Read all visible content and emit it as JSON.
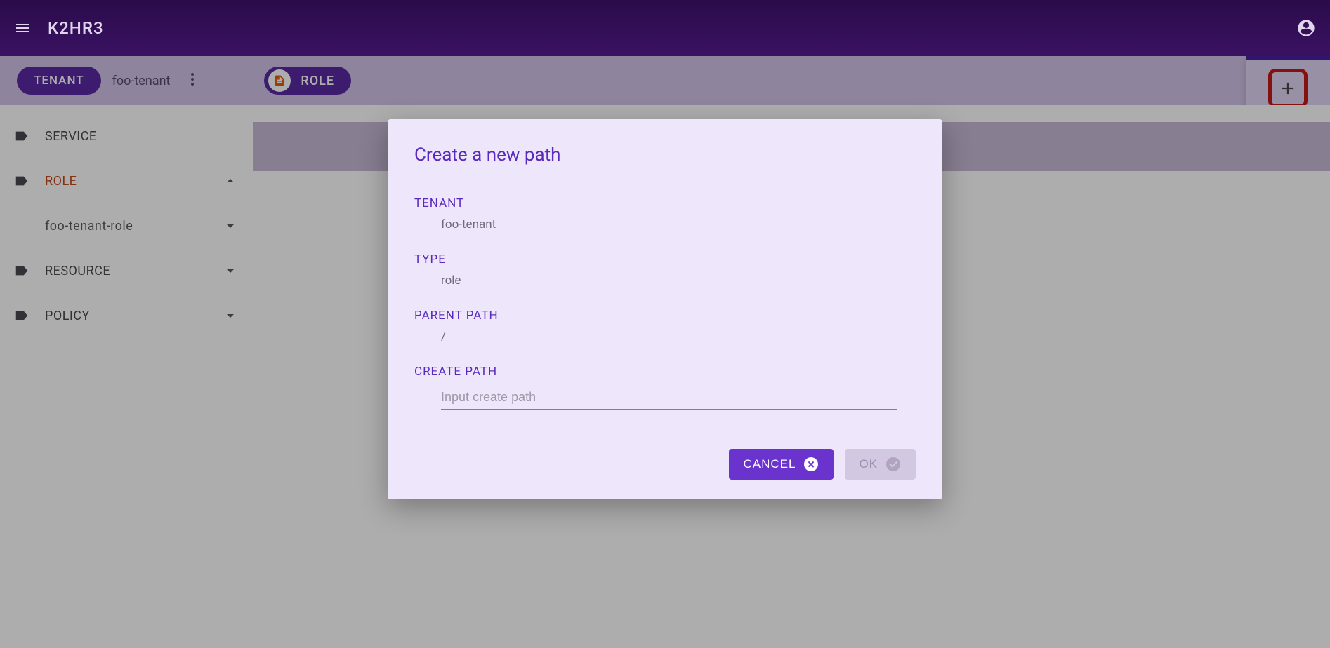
{
  "header": {
    "app_title": "K2HR3"
  },
  "toolbar": {
    "tenant_chip": "TENANT",
    "tenant_name": "foo-tenant",
    "role_chip": "ROLE"
  },
  "sidebar": {
    "items": [
      {
        "label": "SERVICE",
        "expandable": false,
        "active": false
      },
      {
        "label": "ROLE",
        "expandable": true,
        "expanded": true,
        "active": true
      },
      {
        "label": "foo-tenant-role",
        "child": true,
        "expandable": true
      },
      {
        "label": "RESOURCE",
        "expandable": true
      },
      {
        "label": "POLICY",
        "expandable": true
      }
    ]
  },
  "dialog": {
    "title": "Create a new path",
    "fields": {
      "tenant_label": "TENANT",
      "tenant_value": "foo-tenant",
      "type_label": "TYPE",
      "type_value": "role",
      "parent_label": "PARENT PATH",
      "parent_value": "/",
      "create_label": "CREATE PATH",
      "create_placeholder": "Input create path"
    },
    "buttons": {
      "cancel": "CANCEL",
      "ok": "OK"
    }
  }
}
